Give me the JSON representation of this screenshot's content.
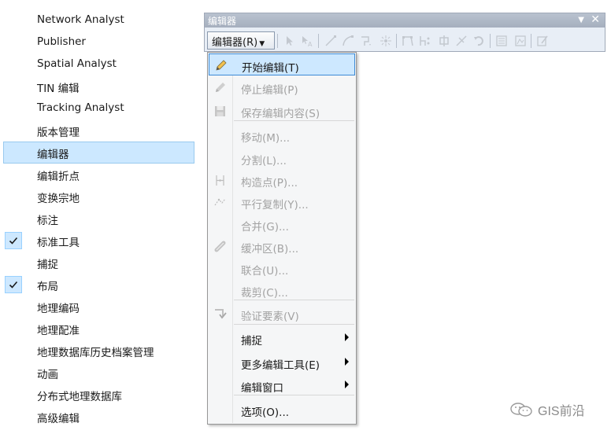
{
  "toolbar_list": {
    "items": [
      {
        "label": "Network Analyst",
        "checked": false,
        "selected": false
      },
      {
        "label": "Publisher",
        "checked": false,
        "selected": false
      },
      {
        "label": "Spatial Analyst",
        "checked": false,
        "selected": false
      },
      {
        "label": "TIN 编辑",
        "checked": false,
        "selected": false
      },
      {
        "label": "Tracking Analyst",
        "checked": false,
        "selected": false
      },
      {
        "label": "版本管理",
        "checked": false,
        "selected": false
      },
      {
        "label": "编辑器",
        "checked": false,
        "selected": true
      },
      {
        "label": "编辑折点",
        "checked": false,
        "selected": false
      },
      {
        "label": "变换宗地",
        "checked": false,
        "selected": false
      },
      {
        "label": "标注",
        "checked": false,
        "selected": false
      },
      {
        "label": "标准工具",
        "checked": true,
        "selected": false
      },
      {
        "label": "捕捉",
        "checked": false,
        "selected": false
      },
      {
        "label": "布局",
        "checked": true,
        "selected": false
      },
      {
        "label": "地理编码",
        "checked": false,
        "selected": false
      },
      {
        "label": "地理配准",
        "checked": false,
        "selected": false
      },
      {
        "label": "地理数据库历史档案管理",
        "checked": false,
        "selected": false
      },
      {
        "label": "动画",
        "checked": false,
        "selected": false
      },
      {
        "label": "分布式地理数据库",
        "checked": false,
        "selected": false
      },
      {
        "label": "高级编辑",
        "checked": false,
        "selected": false
      }
    ]
  },
  "editor_window": {
    "title": "编辑器",
    "menu_button_label": "编辑器(R)",
    "title_dropdown_icon": "dropdown-arrow-icon",
    "title_close_icon": "close-icon"
  },
  "editor_menu": {
    "items": [
      {
        "label": "开始编辑(T)",
        "icon": "pencil-icon",
        "enabled": true,
        "highlighted": true,
        "submenu": false
      },
      {
        "label": "停止编辑(P)",
        "icon": "pencil-stop-icon",
        "enabled": false,
        "highlighted": false,
        "submenu": false
      },
      {
        "label": "保存编辑内容(S)",
        "icon": "save-icon",
        "enabled": false,
        "highlighted": false,
        "submenu": false
      },
      {
        "label": "移动(M)...",
        "icon": "",
        "enabled": false,
        "highlighted": false,
        "submenu": false
      },
      {
        "label": "分割(L)...",
        "icon": "",
        "enabled": false,
        "highlighted": false,
        "submenu": false
      },
      {
        "label": "构造点(P)...",
        "icon": "construct-points-icon",
        "enabled": false,
        "highlighted": false,
        "submenu": false
      },
      {
        "label": "平行复制(Y)...",
        "icon": "copy-parallel-icon",
        "enabled": false,
        "highlighted": false,
        "submenu": false
      },
      {
        "label": "合并(G)...",
        "icon": "",
        "enabled": false,
        "highlighted": false,
        "submenu": false
      },
      {
        "label": "缓冲区(B)...",
        "icon": "buffer-icon",
        "enabled": false,
        "highlighted": false,
        "submenu": false
      },
      {
        "label": "联合(U)...",
        "icon": "",
        "enabled": false,
        "highlighted": false,
        "submenu": false
      },
      {
        "label": "裁剪(C)...",
        "icon": "",
        "enabled": false,
        "highlighted": false,
        "submenu": false
      },
      {
        "label": "验证要素(V)",
        "icon": "validate-icon",
        "enabled": false,
        "highlighted": false,
        "submenu": false
      },
      {
        "label": "捕捉",
        "icon": "",
        "enabled": true,
        "highlighted": false,
        "submenu": true
      },
      {
        "label": "更多编辑工具(E)",
        "icon": "",
        "enabled": true,
        "highlighted": false,
        "submenu": true
      },
      {
        "label": "编辑窗口",
        "icon": "",
        "enabled": true,
        "highlighted": false,
        "submenu": true
      },
      {
        "label": "选项(O)...",
        "icon": "",
        "enabled": true,
        "highlighted": false,
        "submenu": false
      }
    ]
  },
  "watermark": {
    "text": "GIS前沿",
    "icon": "wechat-icon"
  }
}
